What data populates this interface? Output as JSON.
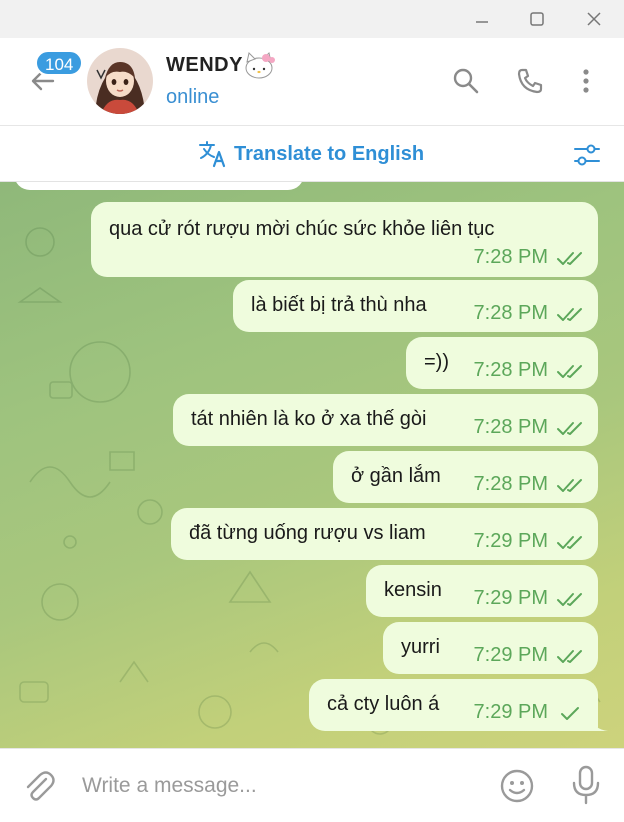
{
  "window": {
    "controls": {
      "minimize_icon": "minimize-icon",
      "maximize_icon": "maximize-icon",
      "close_icon": "close-icon"
    }
  },
  "header": {
    "unread_count": "104",
    "contact_name": "WENDY",
    "contact_status": "online",
    "name_emoji_icon": "hello-kitty-emoji"
  },
  "translate_bar": {
    "label": "Translate to English",
    "icon": "translate-icon",
    "settings_icon": "sliders-icon"
  },
  "messages": [
    {
      "text": "qua cử rót rượu mời chúc sức khỏe liên tục",
      "time": "7:28 PM",
      "status": "read"
    },
    {
      "text": "là biết bị trả thù nha",
      "time": "7:28 PM",
      "status": "read"
    },
    {
      "text": "=))",
      "time": "7:28 PM",
      "status": "read"
    },
    {
      "text": "tát nhiên là ko ở xa thế gòi",
      "time": "7:28 PM",
      "status": "read"
    },
    {
      "text": "ở gần lắm",
      "time": "7:28 PM",
      "status": "read"
    },
    {
      "text": "đã từng uống rượu vs liam",
      "time": "7:29 PM",
      "status": "read"
    },
    {
      "text": "kensin",
      "time": "7:29 PM",
      "status": "read"
    },
    {
      "text": "yurri",
      "time": "7:29 PM",
      "status": "read"
    },
    {
      "text": "cả cty luôn á",
      "time": "7:29 PM",
      "status": "sent"
    }
  ],
  "composer": {
    "placeholder": "Write a message..."
  },
  "colors": {
    "accent": "#3a9ce0",
    "bubble_out": "#effcdd",
    "time_green": "#5ca75a",
    "chat_bg_start": "#8fb87a",
    "chat_bg_end": "#cdd37c"
  }
}
